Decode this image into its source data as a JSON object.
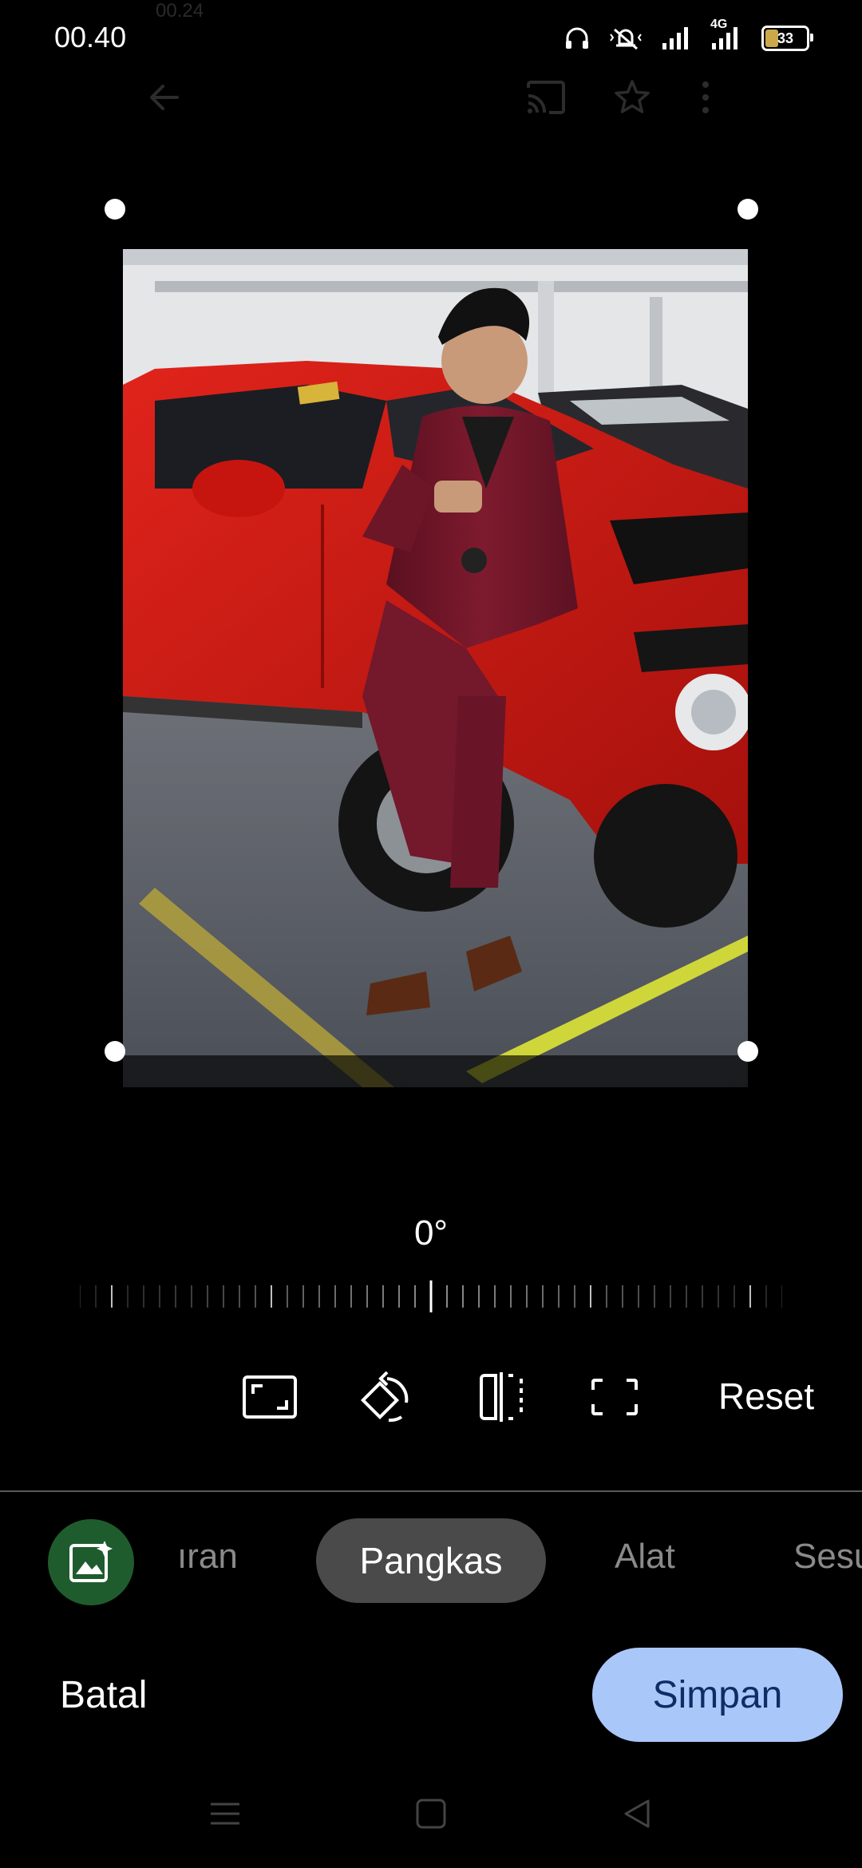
{
  "status_bar": {
    "time": "00.40",
    "ghost_time": "00.24",
    "network_type": "4G",
    "battery_level": "33"
  },
  "toolbar": {
    "back_icon": "arrow-left-icon",
    "cast_icon": "cast-icon",
    "favorite_icon": "star-icon",
    "more_icon": "more-vertical-icon"
  },
  "photo": {
    "subject": "photo-content"
  },
  "rotation": {
    "angle_label": "0°"
  },
  "tools": {
    "aspect_icon": "aspect-ratio-icon",
    "rotate_icon": "rotate-icon",
    "flip_icon": "flip-horizontal-icon",
    "free_crop_icon": "free-crop-icon",
    "reset_label": "Reset"
  },
  "tabs": {
    "magic_icon": "magic-editor-icon",
    "items": [
      {
        "label": "ıran"
      },
      {
        "label": "Pangkas",
        "active": true
      },
      {
        "label": "Alat"
      },
      {
        "label": "Sesu"
      }
    ]
  },
  "actions": {
    "cancel_label": "Batal",
    "save_label": "Simpan"
  },
  "nav_bar": {
    "menu_icon": "menu-icon",
    "home_icon": "home-square-icon",
    "back_icon": "back-triangle-icon"
  },
  "colors": {
    "save_bg": "#aac7f9",
    "save_text": "#0e2d66",
    "active_tab_bg": "#4a4a4a",
    "magic_bg": "#1f5c2d"
  }
}
